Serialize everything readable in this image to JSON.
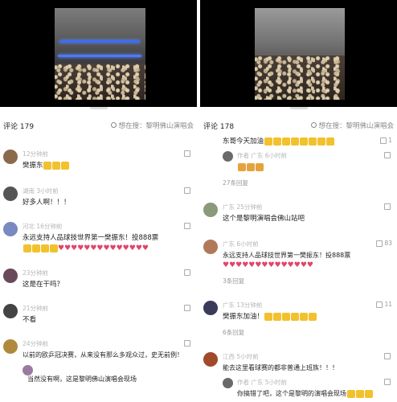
{
  "left": {
    "comments_header": "评论 179",
    "search_hint": "想在搜：黎明佛山演唱会",
    "comments": [
      {
        "meta": "12分钟前",
        "text": "樊振东",
        "emoji_count": 3,
        "likes": ""
      },
      {
        "meta": "湖南 3小时前",
        "text": "好多人啊！！！",
        "likes": ""
      },
      {
        "meta": "河北 16分钟前",
        "text": "永远支持人品球技世界第一樊振东！投888票",
        "text2": "",
        "emoji_count": 4,
        "hearts": 14,
        "likes": ""
      },
      {
        "meta": "23分钟前",
        "text": "这是在干吗？",
        "likes": ""
      },
      {
        "meta": "21分钟前",
        "text": "不看",
        "likes": ""
      },
      {
        "meta": "24分钟前",
        "text": "以前的欧乒冠决赛，从来没有那么多观众过，史无前例！",
        "likes": ""
      },
      {
        "meta": "",
        "text": "当然没有啊，这是黎明佛山演唱会现场",
        "likes": ""
      }
    ]
  },
  "right": {
    "comments_header": "评论 178",
    "search_hint": "想在搜：黎明佛山演唱会",
    "comments": [
      {
        "meta": "",
        "text": "东哥今天加油",
        "emoji_count": 8,
        "likes": "1"
      },
      {
        "meta": "作者 广东 6小时前",
        "text": "",
        "likes": ""
      },
      {
        "meta": "27条回复",
        "text": ""
      },
      {
        "meta": "广东 25分钟前",
        "text": "这个是黎明演唱会佛山站吧",
        "likes": ""
      },
      {
        "meta": "广东 6小时前",
        "text": "永远支持人品球技世界第一樊振东！投888票",
        "hearts": 14,
        "likes": "83"
      },
      {
        "meta": "3条回复",
        "text": ""
      },
      {
        "meta": "广东 13分钟前",
        "text": "樊振东加油！",
        "emoji_count": 6,
        "likes": "11"
      },
      {
        "meta": "6条回复",
        "text": ""
      },
      {
        "meta": "江西 5小时前",
        "text": "能去这里看球赛的都非普通上班族！！！",
        "likes": ""
      },
      {
        "meta": "作者 广东 5小时前",
        "text": "你搞错了吧，这个是黎明的演唱会现场",
        "likes": ""
      }
    ]
  }
}
